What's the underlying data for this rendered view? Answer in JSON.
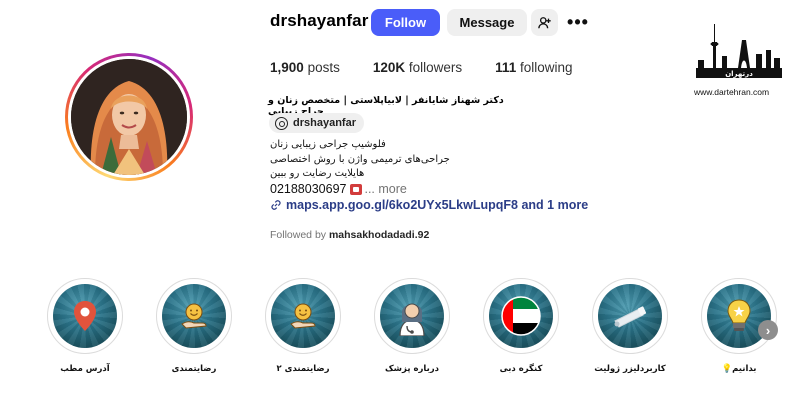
{
  "profile": {
    "username": "drshayanfar",
    "follow_label": "Follow",
    "message_label": "Message",
    "more_label": "•••"
  },
  "stats": {
    "posts_count": "1,900",
    "posts_label": "posts",
    "followers_count": "120K",
    "followers_label": "followers",
    "following_count": "111",
    "following_label": "following"
  },
  "bio": {
    "title": "دکتر شهناز شایانفر | لابیاپلاستی | متخصص زنان و جراح زیبایی",
    "threads_handle": "drshayanfar",
    "line1": "فلوشیپ جراحی زیبایی زنان",
    "line2": "جراحی‌های ترمیمی واژن با روش اختصاصی",
    "line3": "هایلایت رضایت رو ببین",
    "phone": "02188030697",
    "more_label": "... more",
    "link": "maps.app.goo.gl/6ko2UYx5LkwLupqF8 and 1 more",
    "followed_prefix": "Followed by",
    "followed_user": "mahsakhodadadi.92"
  },
  "watermark": {
    "logo_text": "درتهران",
    "url": "www.dartehran.com"
  },
  "highlights": [
    {
      "label": "آدرس مطب",
      "icon": "location-pin-icon"
    },
    {
      "label": "رضایتمندی",
      "icon": "hand-smile-icon"
    },
    {
      "label": "رضایتمندی ۲",
      "icon": "hand-smile-icon"
    },
    {
      "label": "درباره پزشک",
      "icon": "doctor-icon"
    },
    {
      "label": "کنگره دبی",
      "icon": "uae-flag-icon"
    },
    {
      "label": "کاربردلیزر ژولیت",
      "icon": "laser-device-icon"
    },
    {
      "label": "بدانیم💡",
      "icon": "lightbulb-icon"
    }
  ],
  "colors": {
    "follow_button": "#4a5df9",
    "link": "#2b3d87",
    "highlight_bg": "#2a7389"
  }
}
